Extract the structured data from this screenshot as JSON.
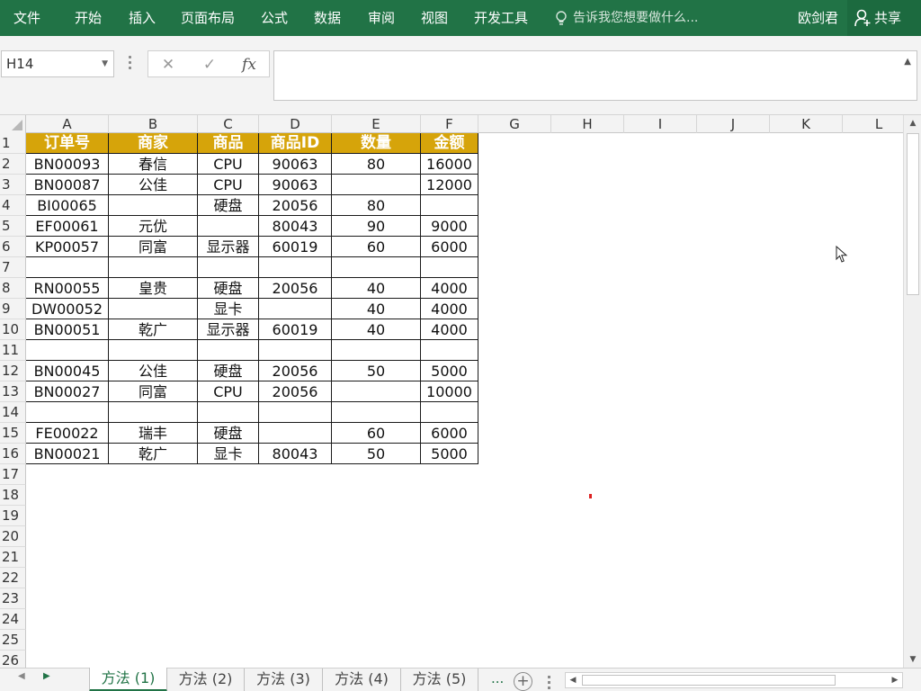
{
  "ribbon": {
    "tabs": [
      "文件",
      "开始",
      "插入",
      "页面布局",
      "公式",
      "数据",
      "审阅",
      "视图",
      "开发工具"
    ],
    "tell_me": "告诉我您想要做什么...",
    "user": "欧剑君",
    "share": "共享",
    "bg_color": "#217346"
  },
  "formula_bar": {
    "name_box": "H14",
    "cancel_icon": "✕",
    "enter_icon": "✓",
    "fx_icon": "fx",
    "formula": ""
  },
  "grid": {
    "columns": [
      "A",
      "B",
      "C",
      "D",
      "E",
      "F",
      "G",
      "H",
      "I",
      "J",
      "K",
      "L"
    ],
    "row_numbers": [
      "1",
      "2",
      "3",
      "4",
      "5",
      "6",
      "7",
      "8",
      "9",
      "10",
      "11",
      "12",
      "13",
      "14",
      "15",
      "16",
      "17",
      "18",
      "19",
      "20",
      "21",
      "22",
      "23",
      "24",
      "25",
      "26"
    ],
    "header_color": "#D6A40A",
    "table_header": [
      "订单号",
      "商家",
      "商品",
      "商品ID",
      "数量",
      "金额"
    ],
    "table_rows": [
      [
        "BN00093",
        "春信",
        "CPU",
        "90063",
        "80",
        "16000"
      ],
      [
        "BN00087",
        "公佳",
        "CPU",
        "90063",
        "",
        "12000"
      ],
      [
        "BI00065",
        "",
        "硬盘",
        "20056",
        "80",
        ""
      ],
      [
        "EF00061",
        "元优",
        "",
        "80043",
        "90",
        "9000"
      ],
      [
        "KP00057",
        "同富",
        "显示器",
        "60019",
        "60",
        "6000"
      ],
      [
        "",
        "",
        "",
        "",
        "",
        ""
      ],
      [
        "RN00055",
        "皇贵",
        "硬盘",
        "20056",
        "40",
        "4000"
      ],
      [
        "DW00052",
        "",
        "显卡",
        "",
        "40",
        "4000"
      ],
      [
        "BN00051",
        "乾广",
        "显示器",
        "60019",
        "40",
        "4000"
      ],
      [
        "",
        "",
        "",
        "",
        "",
        ""
      ],
      [
        "BN00045",
        "公佳",
        "硬盘",
        "20056",
        "50",
        "5000"
      ],
      [
        "BN00027",
        "同富",
        "CPU",
        "20056",
        "",
        "10000"
      ],
      [
        "",
        "",
        "",
        "",
        "",
        ""
      ],
      [
        "FE00022",
        "瑞丰",
        "硬盘",
        "",
        "60",
        "6000"
      ],
      [
        "BN00021",
        "乾广",
        "显卡",
        "80043",
        "50",
        "5000"
      ]
    ]
  },
  "sheet_tabs": {
    "tabs": [
      "方法 (1)",
      "方法 (2)",
      "方法 (3)",
      "方法 (4)",
      "方法 (5)"
    ],
    "active_index": 0,
    "more": "...",
    "add": "+"
  }
}
